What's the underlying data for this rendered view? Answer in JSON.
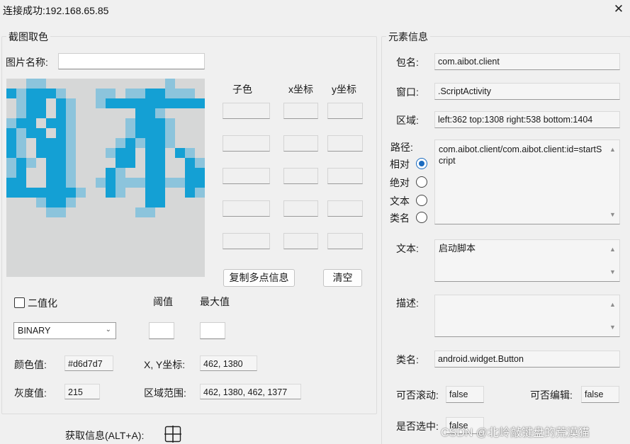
{
  "window": {
    "title": "连接成功:192.168.65.85",
    "close_glyph": "✕"
  },
  "capture": {
    "legend": "截图取色",
    "image_name_label": "图片名称:",
    "image_name_value": "",
    "point_headers": {
      "color": "子色",
      "x": "x坐标",
      "y": "y坐标"
    },
    "copy_button": "复制多点信息",
    "clear_button": "清空",
    "binarize_label": "二值化",
    "threshold_label": "阈值",
    "max_label": "最大值",
    "threshold_value": "",
    "max_value": "",
    "mode_select": "BINARY",
    "color_label": "颜色值:",
    "color_value": "#d6d7d7",
    "xy_label": "X, Y坐标:",
    "xy_value": "462, 1380",
    "gray_label": "灰度值:",
    "gray_value": "215",
    "range_label": "区域范围:",
    "range_value": "462, 1380, 462, 1377",
    "fetch_label": "获取信息(ALT+A):",
    "colors": {
      "pixel_blue": "#14a0d4",
      "pixel_light": "#8cc4dc",
      "pixel_bg": "#d6d7d7"
    }
  },
  "element": {
    "legend": "元素信息",
    "package_label": "包名:",
    "package_value": "com.aibot.client",
    "window_label": "窗口:",
    "window_value": ".ScriptActivity",
    "area_label": "区域:",
    "area_value": "left:362 top:1308 right:538 bottom:1404",
    "path_label": "路径:",
    "path_options": [
      {
        "label": "相对",
        "checked": true
      },
      {
        "label": "绝对",
        "checked": false
      },
      {
        "label": "文本",
        "checked": false
      },
      {
        "label": "类名",
        "checked": false
      }
    ],
    "path_value": "com.aibot.client/com.aibot.client:id=startScript",
    "text_label": "文本:",
    "text_value": "启动脚本",
    "desc_label": "描述:",
    "desc_value": "",
    "class_label": "类名:",
    "class_value": "android.widget.Button",
    "scrollable_label": "可否滚动:",
    "scrollable_value": "false",
    "editable_label": "可否编辑:",
    "editable_value": "false",
    "selected_label": "是否选中:",
    "selected_value": "false"
  },
  "watermark": "CSDN @北岭敲键盘的荒漠猫"
}
